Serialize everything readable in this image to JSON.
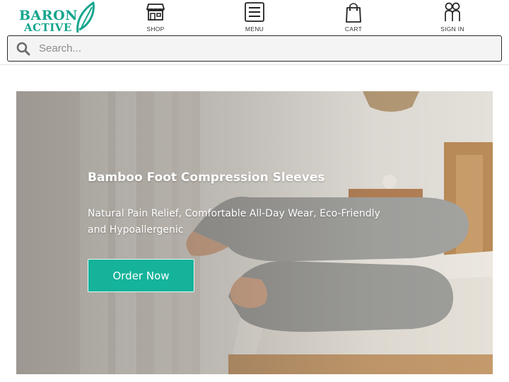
{
  "brand": {
    "line1": "BARON",
    "line2": "ACTIVE",
    "color": "#14a58d",
    "icon": "leaf-icon"
  },
  "nav": {
    "shop": {
      "label": "SHOP",
      "icon": "storefront-icon"
    },
    "menu": {
      "label": "MENU",
      "icon": "hamburger-menu-icon"
    },
    "cart": {
      "label": "CART",
      "icon": "shopping-bag-icon"
    },
    "signin": {
      "label": "SIGN IN",
      "icon": "users-icon"
    }
  },
  "search": {
    "placeholder": "Search...",
    "value": "",
    "icon": "search-icon"
  },
  "hero": {
    "title": "Bamboo Foot Compression Sleeves",
    "subtitle": "Natural Pain Relief, Comfortable All-Day Wear, Eco-Friendly and Hypoallergenic",
    "cta_label": "Order Now",
    "cta_color": "#14b39a"
  }
}
